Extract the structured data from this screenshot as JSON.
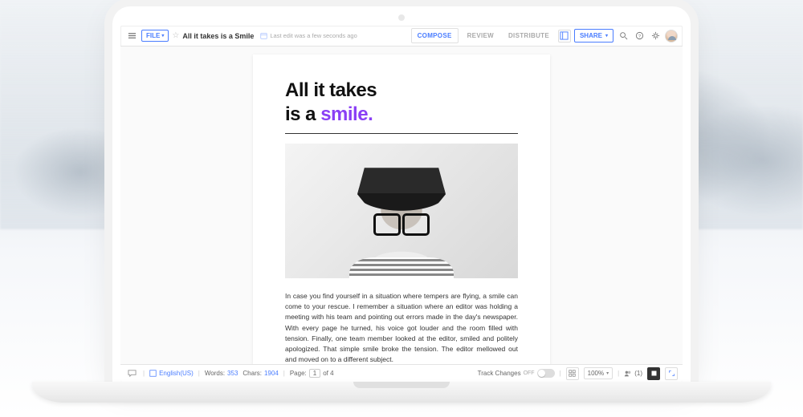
{
  "toolbar": {
    "file_label": "FILE",
    "doc_title": "All it takes is a Smile",
    "save_status": "Last edit was a few seconds ago",
    "tabs": {
      "compose": "COMPOSE",
      "review": "REVIEW",
      "distribute": "DISTRIBUTE"
    },
    "share_label": "SHARE"
  },
  "document": {
    "heading_line1": "All it takes",
    "heading_line2_a": "is a ",
    "heading_line2_b": "smile.",
    "body": "In case you find yourself in a situation where tempers are flying, a smile can come to your rescue. I remember a situation where an editor was holding a meeting with his team and pointing out errors made in the day's newspaper. With every page he turned, his voice got louder and the room filled with tension. Finally, one team member looked at the editor, smiled and politely apologized. That simple smile broke the tension. The editor mellowed out and moved on to a different subject."
  },
  "statusbar": {
    "language": "English(US)",
    "words_label": "Words:",
    "words_value": "353",
    "chars_label": "Chars:",
    "chars_value": "1904",
    "page_label": "Page:",
    "page_current": "1",
    "page_of": "of 4",
    "track_changes_label": "Track Changes",
    "track_changes_state": "OFF",
    "zoom": "100%",
    "collab_count": "(1)"
  }
}
